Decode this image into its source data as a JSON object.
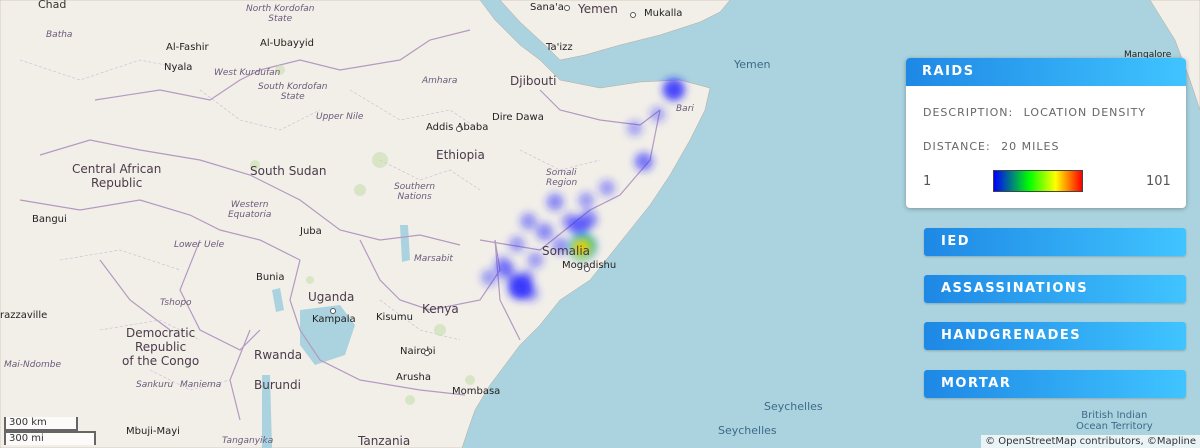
{
  "map": {
    "labels": {
      "chad": "Chad",
      "north_kordofan": "North Kordofan\nState",
      "batha": "Batha",
      "al_fashir": "Al-Fashir",
      "al_ubayyid": "Al-Ubayyid",
      "nyala": "Nyala",
      "west_kurdufan": "West Kurdufan",
      "south_kordofan": "South Kordofan\nState",
      "sanaa": "Sana'a",
      "yemen_top": "Yemen",
      "mukalla": "Mukalla",
      "taizz": "Ta'izz",
      "yemen_sea": "Yemen",
      "amhara": "Amhara",
      "djibouti": "Djibouti",
      "upper_nile": "Upper Nile",
      "addis_ababa": "Addis Ababa",
      "dire_dawa": "Dire Dawa",
      "bari": "Bari",
      "central_african_republic": "Central African\nRepublic",
      "south_sudan": "South Sudan",
      "ethiopia": "Ethiopia",
      "somali_region": "Somali\nRegion",
      "southern_nations": "Southern\nNations",
      "western_equatoria": "Western\nEquatoria",
      "bangui": "Bangui",
      "juba": "Juba",
      "somalia": "Somalia",
      "mogadishu": "Mogadishu",
      "lower_uele": "Lower Uele",
      "marsabit": "Marsabit",
      "bunia": "Bunia",
      "tshopo": "Tshopo",
      "uganda": "Uganda",
      "kenya": "Kenya",
      "brazzaville": "razzaville",
      "kampala": "Kampala",
      "kisumu": "Kisumu",
      "drc": "Democratic\nRepublic\nof the Congo",
      "rwanda": "Rwanda",
      "nairobi": "Nairobi",
      "mai_ndombe": "Mai-Ndombe",
      "sankuru": "Sankuru",
      "maniema": "Maniema",
      "burundi": "Burundi",
      "arusha": "Arusha",
      "mombasa": "Mombasa",
      "seychelles_1": "Seychelles",
      "seychelles_2": "Seychelles",
      "mbuji_mayi": "Mbuji-Mayi",
      "tanganyika": "Tanganyika",
      "tanzania": "Tanzania",
      "british_indian": "British Indian\nOcean Territory",
      "mangalore": "Mangalore"
    },
    "heat_points": [
      {
        "lon": 45.3,
        "lat": 2.0,
        "intensity": 101
      },
      {
        "lon": 45.2,
        "lat": 1.9,
        "intensity": 60
      },
      {
        "lon": 42.55,
        "lat": -0.35,
        "intensity": 18
      },
      {
        "lon": 49.2,
        "lat": 10.9,
        "intensity": 14
      },
      {
        "lon": 47.9,
        "lat": 6.8,
        "intensity": 8
      },
      {
        "lon": 44.05,
        "lat": 4.5,
        "intensity": 6
      },
      {
        "lon": 45.1,
        "lat": 3.1,
        "intensity": 9
      },
      {
        "lon": 45.5,
        "lat": 3.5,
        "intensity": 7
      },
      {
        "lon": 41.8,
        "lat": 0.9,
        "intensity": 6
      },
      {
        "lon": 43.6,
        "lat": 2.8,
        "intensity": 6
      },
      {
        "lon": 44.3,
        "lat": 2.0,
        "intensity": 5
      },
      {
        "lon": 42.9,
        "lat": 3.4,
        "intensity": 5
      },
      {
        "lon": 41.2,
        "lat": 0.2,
        "intensity": 4
      },
      {
        "lon": 42.0,
        "lat": 0.5,
        "intensity": 5
      },
      {
        "lon": 43.2,
        "lat": 1.2,
        "intensity": 4
      },
      {
        "lon": 46.3,
        "lat": 5.3,
        "intensity": 4
      },
      {
        "lon": 44.7,
        "lat": 3.4,
        "intensity": 5
      },
      {
        "lon": 42.4,
        "lat": 2.1,
        "intensity": 4
      },
      {
        "lon": 43.0,
        "lat": -0.7,
        "intensity": 4
      },
      {
        "lon": 48.5,
        "lat": 9.5,
        "intensity": 3
      },
      {
        "lon": 47.5,
        "lat": 8.7,
        "intensity": 3
      },
      {
        "lon": 45.4,
        "lat": 4.6,
        "intensity": 4
      },
      {
        "lon": 42.8,
        "lat": 0.2,
        "intensity": 4
      }
    ]
  },
  "panel": {
    "title": "RAIDS",
    "description_label": "DESCRIPTION:",
    "description_value": "LOCATION DENSITY",
    "distance_label": "DISTANCE:",
    "distance_value": "20 MILES",
    "legend_min": "1",
    "legend_max": "101",
    "colors": [
      "#0000ff",
      "#00ff00",
      "#ffff00",
      "#ff0000"
    ]
  },
  "categories": [
    "IED",
    "ASSASSINATIONS",
    "HANDGRENADES",
    "MORTAR"
  ],
  "scale": {
    "km": "300 km",
    "mi": "300 mi"
  },
  "attribution": "© OpenStreetMap contributors, ©Mapline"
}
